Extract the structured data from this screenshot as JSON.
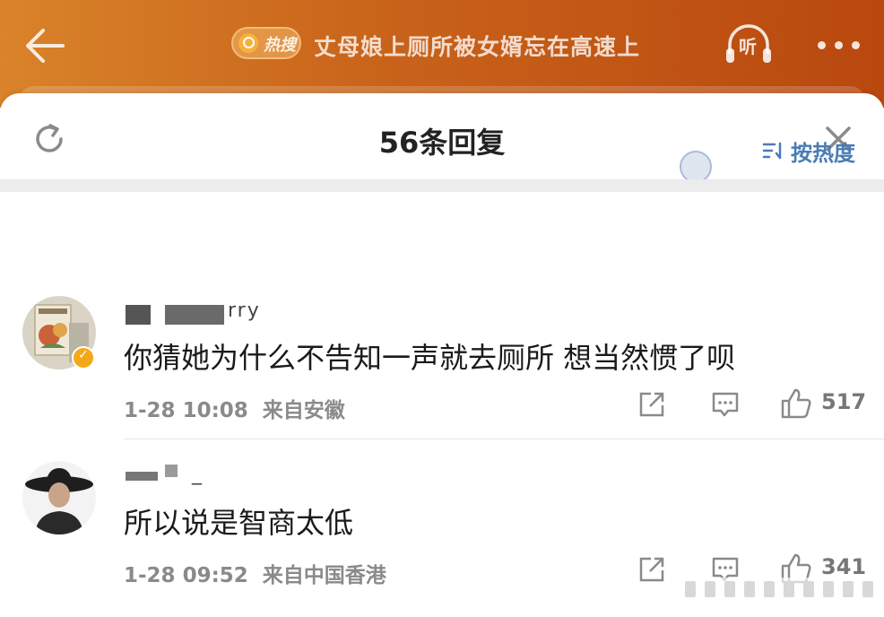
{
  "header": {
    "hot_badge": "热搜",
    "title": "丈母娘上厕所被女婿忘在高速上",
    "listen_label": "听"
  },
  "sheet": {
    "reply_count": "56条回复",
    "sort_label": "按热度"
  },
  "comments": [
    {
      "username_visible": "rry",
      "text": "你猜她为什么不告知一声就去厕所 想当然惯了呗",
      "time": "1-28 10:08",
      "location": "来自安徽",
      "likes": "517",
      "verified": true
    },
    {
      "username_visible": "_",
      "text": "所以说是智商太低",
      "time": "1-28 09:52",
      "location": "来自中国香港",
      "likes": "341",
      "verified": false
    }
  ],
  "colors": {
    "header_start": "#d9832a",
    "header_end": "#b9480f",
    "sort_blue": "#4a7cb3",
    "verified": "#f3a917"
  },
  "icons": [
    "back-arrow-icon",
    "search-icon",
    "headphones-icon",
    "more-icon",
    "refresh-icon",
    "close-icon",
    "sort-icon",
    "share-icon",
    "comment-icon",
    "thumbs-up-icon"
  ]
}
